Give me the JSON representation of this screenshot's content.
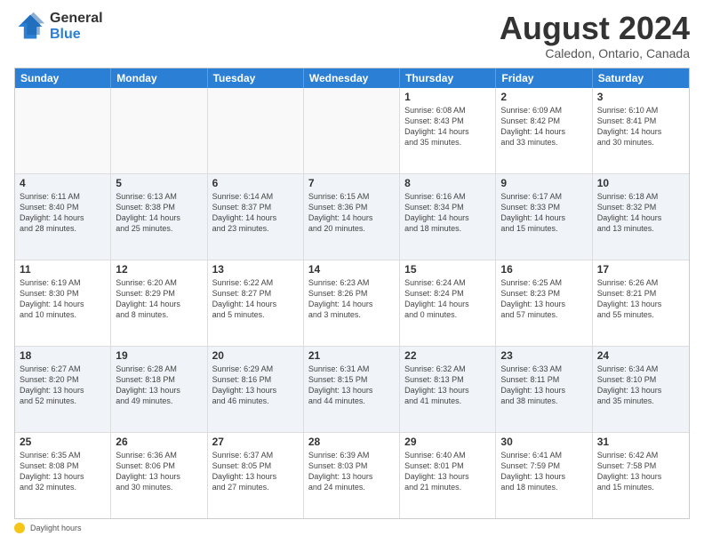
{
  "logo": {
    "line1": "General",
    "line2": "Blue"
  },
  "title": "August 2024",
  "location": "Caledon, Ontario, Canada",
  "weekdays": [
    "Sunday",
    "Monday",
    "Tuesday",
    "Wednesday",
    "Thursday",
    "Friday",
    "Saturday"
  ],
  "footer": {
    "label": "Daylight hours"
  },
  "weeks": [
    [
      {
        "day": "",
        "info": ""
      },
      {
        "day": "",
        "info": ""
      },
      {
        "day": "",
        "info": ""
      },
      {
        "day": "",
        "info": ""
      },
      {
        "day": "1",
        "info": "Sunrise: 6:08 AM\nSunset: 8:43 PM\nDaylight: 14 hours\nand 35 minutes."
      },
      {
        "day": "2",
        "info": "Sunrise: 6:09 AM\nSunset: 8:42 PM\nDaylight: 14 hours\nand 33 minutes."
      },
      {
        "day": "3",
        "info": "Sunrise: 6:10 AM\nSunset: 8:41 PM\nDaylight: 14 hours\nand 30 minutes."
      }
    ],
    [
      {
        "day": "4",
        "info": "Sunrise: 6:11 AM\nSunset: 8:40 PM\nDaylight: 14 hours\nand 28 minutes."
      },
      {
        "day": "5",
        "info": "Sunrise: 6:13 AM\nSunset: 8:38 PM\nDaylight: 14 hours\nand 25 minutes."
      },
      {
        "day": "6",
        "info": "Sunrise: 6:14 AM\nSunset: 8:37 PM\nDaylight: 14 hours\nand 23 minutes."
      },
      {
        "day": "7",
        "info": "Sunrise: 6:15 AM\nSunset: 8:36 PM\nDaylight: 14 hours\nand 20 minutes."
      },
      {
        "day": "8",
        "info": "Sunrise: 6:16 AM\nSunset: 8:34 PM\nDaylight: 14 hours\nand 18 minutes."
      },
      {
        "day": "9",
        "info": "Sunrise: 6:17 AM\nSunset: 8:33 PM\nDaylight: 14 hours\nand 15 minutes."
      },
      {
        "day": "10",
        "info": "Sunrise: 6:18 AM\nSunset: 8:32 PM\nDaylight: 14 hours\nand 13 minutes."
      }
    ],
    [
      {
        "day": "11",
        "info": "Sunrise: 6:19 AM\nSunset: 8:30 PM\nDaylight: 14 hours\nand 10 minutes."
      },
      {
        "day": "12",
        "info": "Sunrise: 6:20 AM\nSunset: 8:29 PM\nDaylight: 14 hours\nand 8 minutes."
      },
      {
        "day": "13",
        "info": "Sunrise: 6:22 AM\nSunset: 8:27 PM\nDaylight: 14 hours\nand 5 minutes."
      },
      {
        "day": "14",
        "info": "Sunrise: 6:23 AM\nSunset: 8:26 PM\nDaylight: 14 hours\nand 3 minutes."
      },
      {
        "day": "15",
        "info": "Sunrise: 6:24 AM\nSunset: 8:24 PM\nDaylight: 14 hours\nand 0 minutes."
      },
      {
        "day": "16",
        "info": "Sunrise: 6:25 AM\nSunset: 8:23 PM\nDaylight: 13 hours\nand 57 minutes."
      },
      {
        "day": "17",
        "info": "Sunrise: 6:26 AM\nSunset: 8:21 PM\nDaylight: 13 hours\nand 55 minutes."
      }
    ],
    [
      {
        "day": "18",
        "info": "Sunrise: 6:27 AM\nSunset: 8:20 PM\nDaylight: 13 hours\nand 52 minutes."
      },
      {
        "day": "19",
        "info": "Sunrise: 6:28 AM\nSunset: 8:18 PM\nDaylight: 13 hours\nand 49 minutes."
      },
      {
        "day": "20",
        "info": "Sunrise: 6:29 AM\nSunset: 8:16 PM\nDaylight: 13 hours\nand 46 minutes."
      },
      {
        "day": "21",
        "info": "Sunrise: 6:31 AM\nSunset: 8:15 PM\nDaylight: 13 hours\nand 44 minutes."
      },
      {
        "day": "22",
        "info": "Sunrise: 6:32 AM\nSunset: 8:13 PM\nDaylight: 13 hours\nand 41 minutes."
      },
      {
        "day": "23",
        "info": "Sunrise: 6:33 AM\nSunset: 8:11 PM\nDaylight: 13 hours\nand 38 minutes."
      },
      {
        "day": "24",
        "info": "Sunrise: 6:34 AM\nSunset: 8:10 PM\nDaylight: 13 hours\nand 35 minutes."
      }
    ],
    [
      {
        "day": "25",
        "info": "Sunrise: 6:35 AM\nSunset: 8:08 PM\nDaylight: 13 hours\nand 32 minutes."
      },
      {
        "day": "26",
        "info": "Sunrise: 6:36 AM\nSunset: 8:06 PM\nDaylight: 13 hours\nand 30 minutes."
      },
      {
        "day": "27",
        "info": "Sunrise: 6:37 AM\nSunset: 8:05 PM\nDaylight: 13 hours\nand 27 minutes."
      },
      {
        "day": "28",
        "info": "Sunrise: 6:39 AM\nSunset: 8:03 PM\nDaylight: 13 hours\nand 24 minutes."
      },
      {
        "day": "29",
        "info": "Sunrise: 6:40 AM\nSunset: 8:01 PM\nDaylight: 13 hours\nand 21 minutes."
      },
      {
        "day": "30",
        "info": "Sunrise: 6:41 AM\nSunset: 7:59 PM\nDaylight: 13 hours\nand 18 minutes."
      },
      {
        "day": "31",
        "info": "Sunrise: 6:42 AM\nSunset: 7:58 PM\nDaylight: 13 hours\nand 15 minutes."
      }
    ]
  ]
}
